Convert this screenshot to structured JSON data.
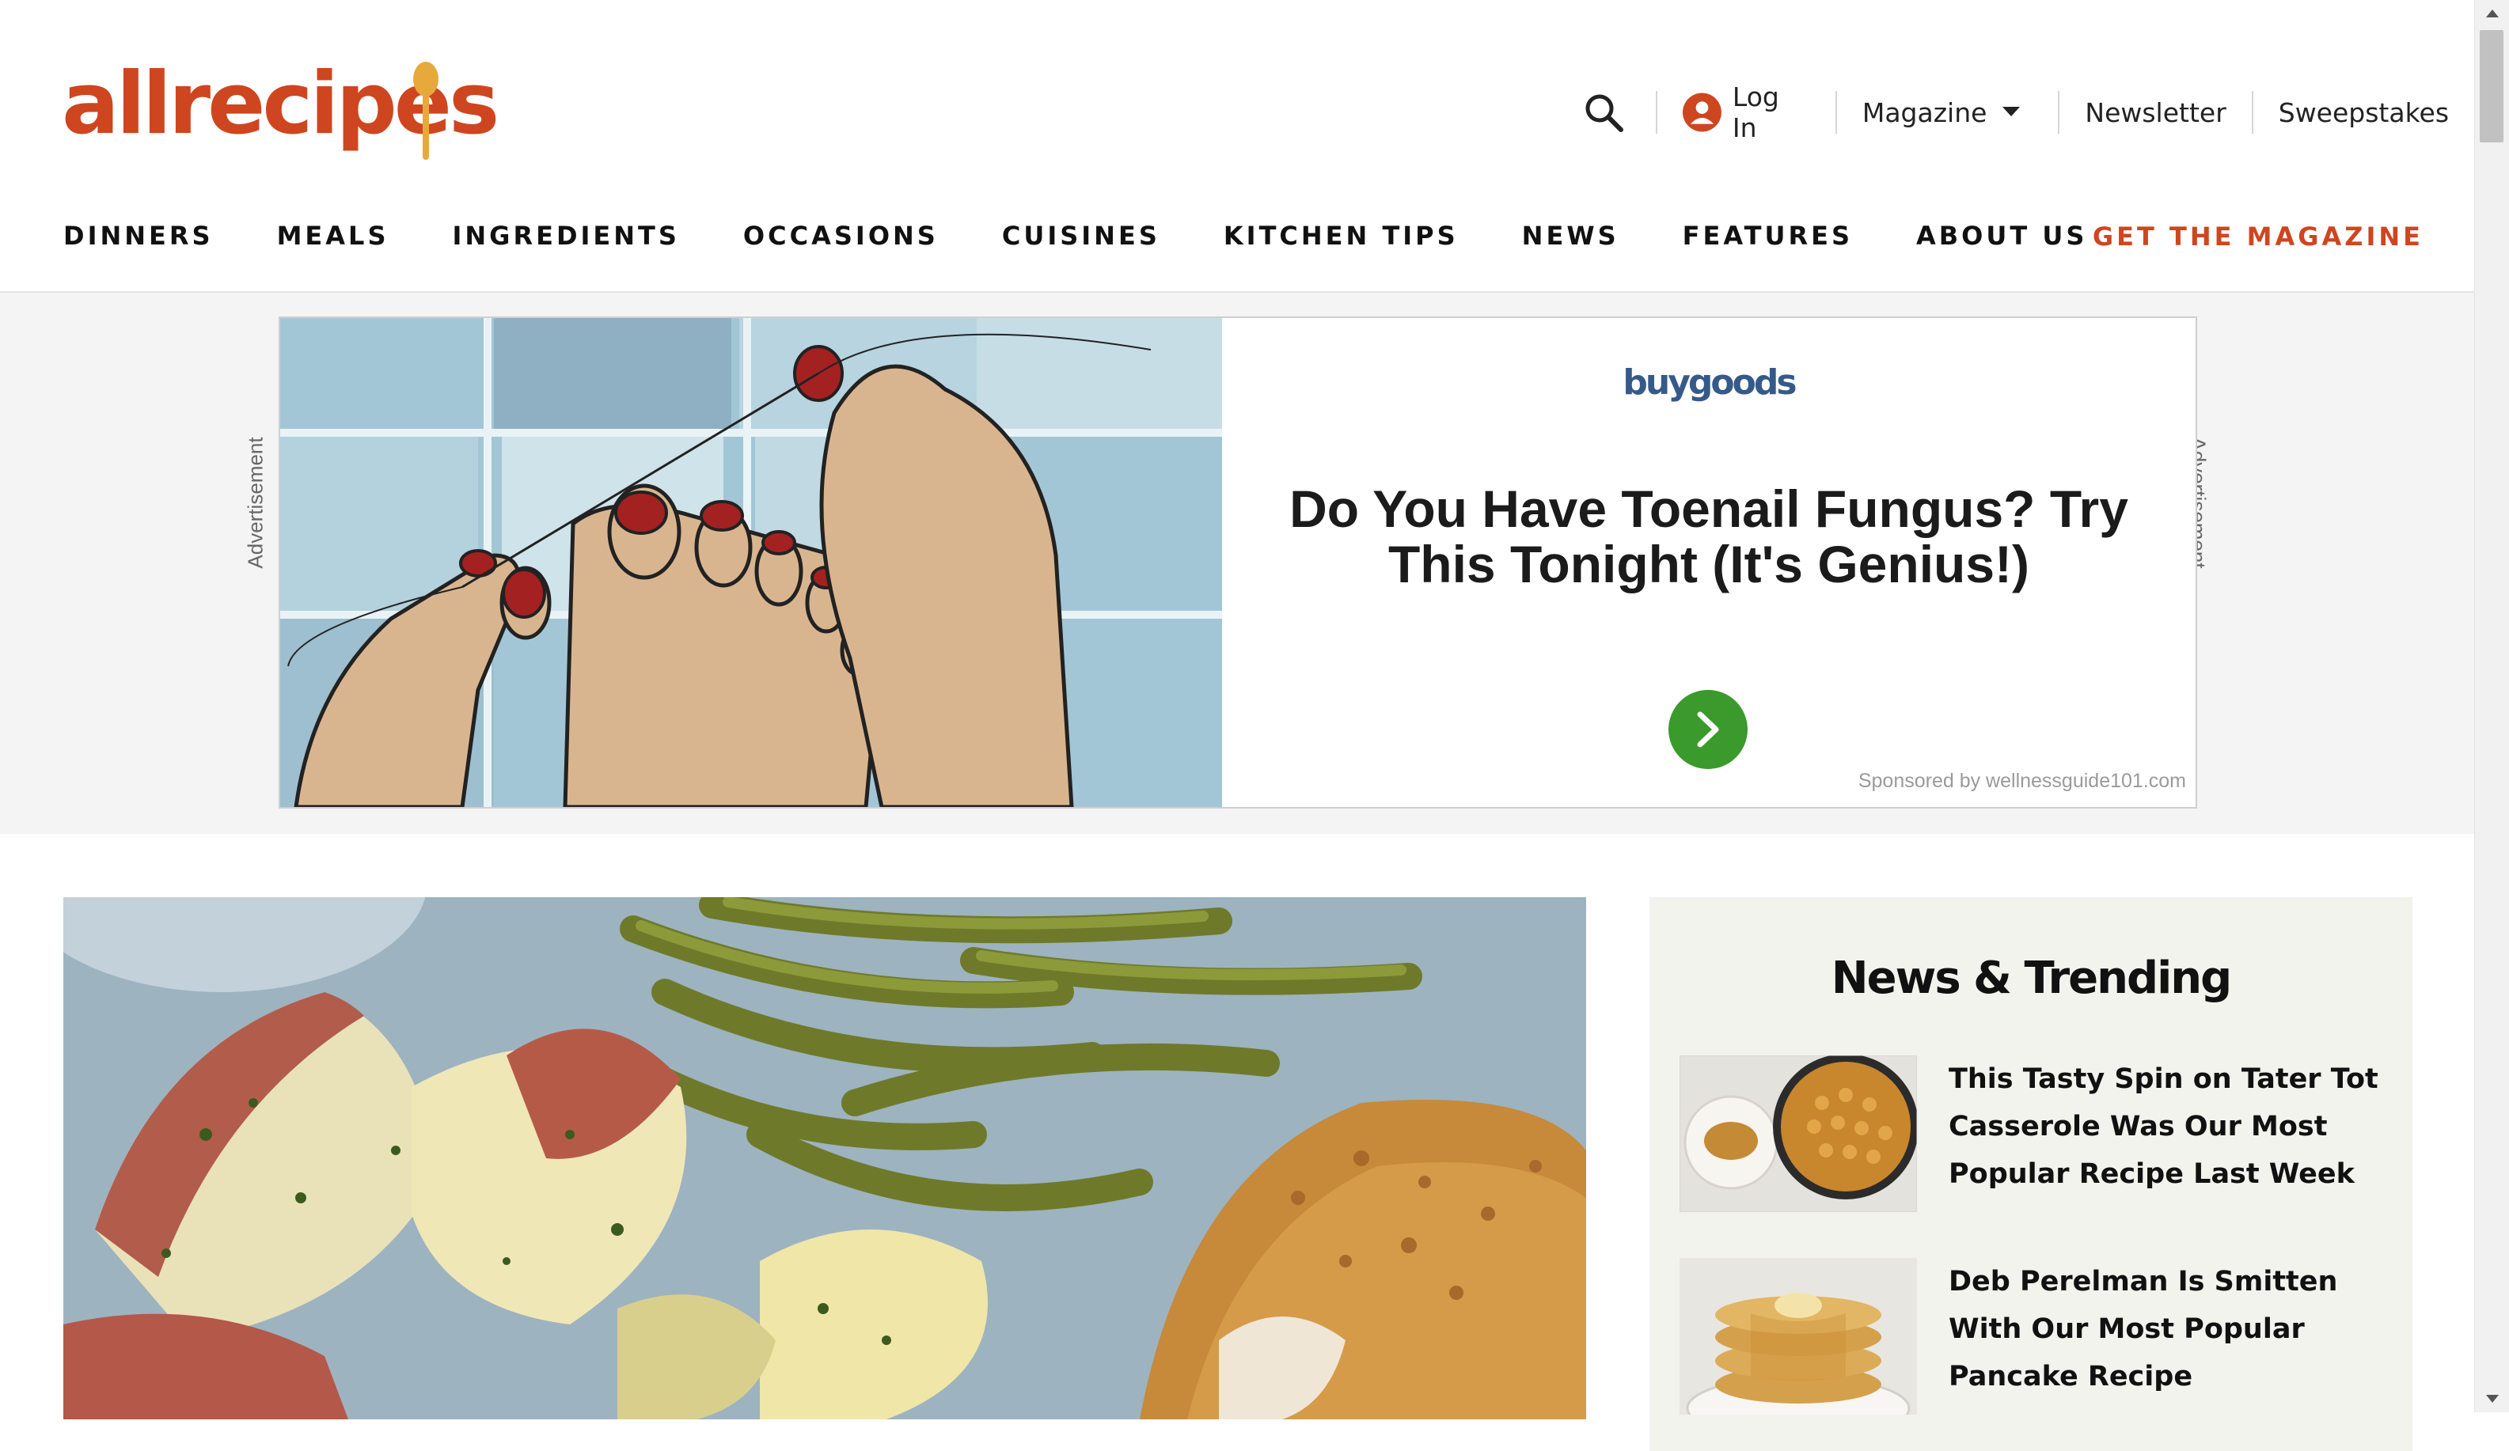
{
  "site": {
    "logo_text": "allrecipes",
    "brand_color": "#ce4620",
    "spoon_color": "#e8a93c"
  },
  "utility": {
    "search_icon": "search-icon",
    "login_label": "Log In",
    "magazine_label": "Magazine",
    "newsletter_label": "Newsletter",
    "sweepstakes_label": "Sweepstakes"
  },
  "nav": {
    "items": [
      {
        "label": "DINNERS"
      },
      {
        "label": "MEALS"
      },
      {
        "label": "INGREDIENTS"
      },
      {
        "label": "OCCASIONS"
      },
      {
        "label": "CUISINES"
      },
      {
        "label": "KITCHEN TIPS"
      },
      {
        "label": "NEWS"
      },
      {
        "label": "FEATURES"
      },
      {
        "label": "ABOUT US"
      }
    ],
    "cta_label": "GET THE MAGAZINE"
  },
  "ad": {
    "side_label": "Advertisement",
    "brand": "buygoods",
    "headline": "Do You Have Toenail Fungus? Try This Tonight (It's Genius!)",
    "sponsor": "Sponsored by wellnessguide101.com",
    "cta_color": "#3a9a2c"
  },
  "trending": {
    "title": "News & Trending",
    "items": [
      {
        "title": "This Tasty Spin on Tater Tot Casserole Was Our Most Popular Recipe Last Week"
      },
      {
        "title": "Deb Perelman Is Smitten With Our Most Popular Pancake Recipe"
      }
    ]
  }
}
